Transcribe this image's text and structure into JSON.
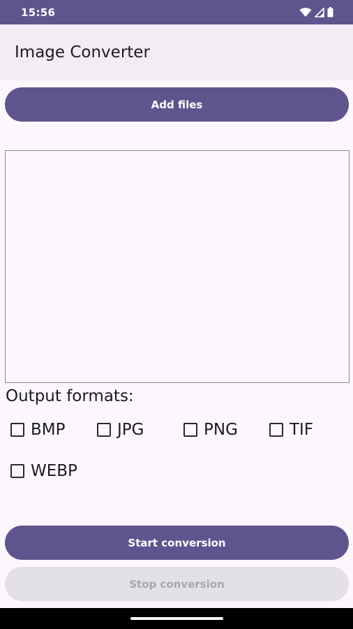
{
  "status_bar": {
    "time": "15:56",
    "icons": [
      "wifi-icon",
      "signal-icon",
      "battery-icon"
    ]
  },
  "app_bar": {
    "title": "Image Converter"
  },
  "add_files_label": "Add files",
  "output_formats": {
    "label": "Output formats:",
    "options": [
      {
        "label": "BMP",
        "checked": false
      },
      {
        "label": "JPG",
        "checked": false
      },
      {
        "label": "PNG",
        "checked": false
      },
      {
        "label": "TIF",
        "checked": false
      },
      {
        "label": "WEBP",
        "checked": false
      }
    ]
  },
  "start_label": "Start conversion",
  "stop_label": "Stop conversion",
  "colors": {
    "primary": "#5f558e",
    "app_bar_bg": "#f2edf4",
    "background": "#fdf7fd",
    "disabled_bg": "#e3e0e6",
    "disabled_text": "#a9a6ae"
  }
}
